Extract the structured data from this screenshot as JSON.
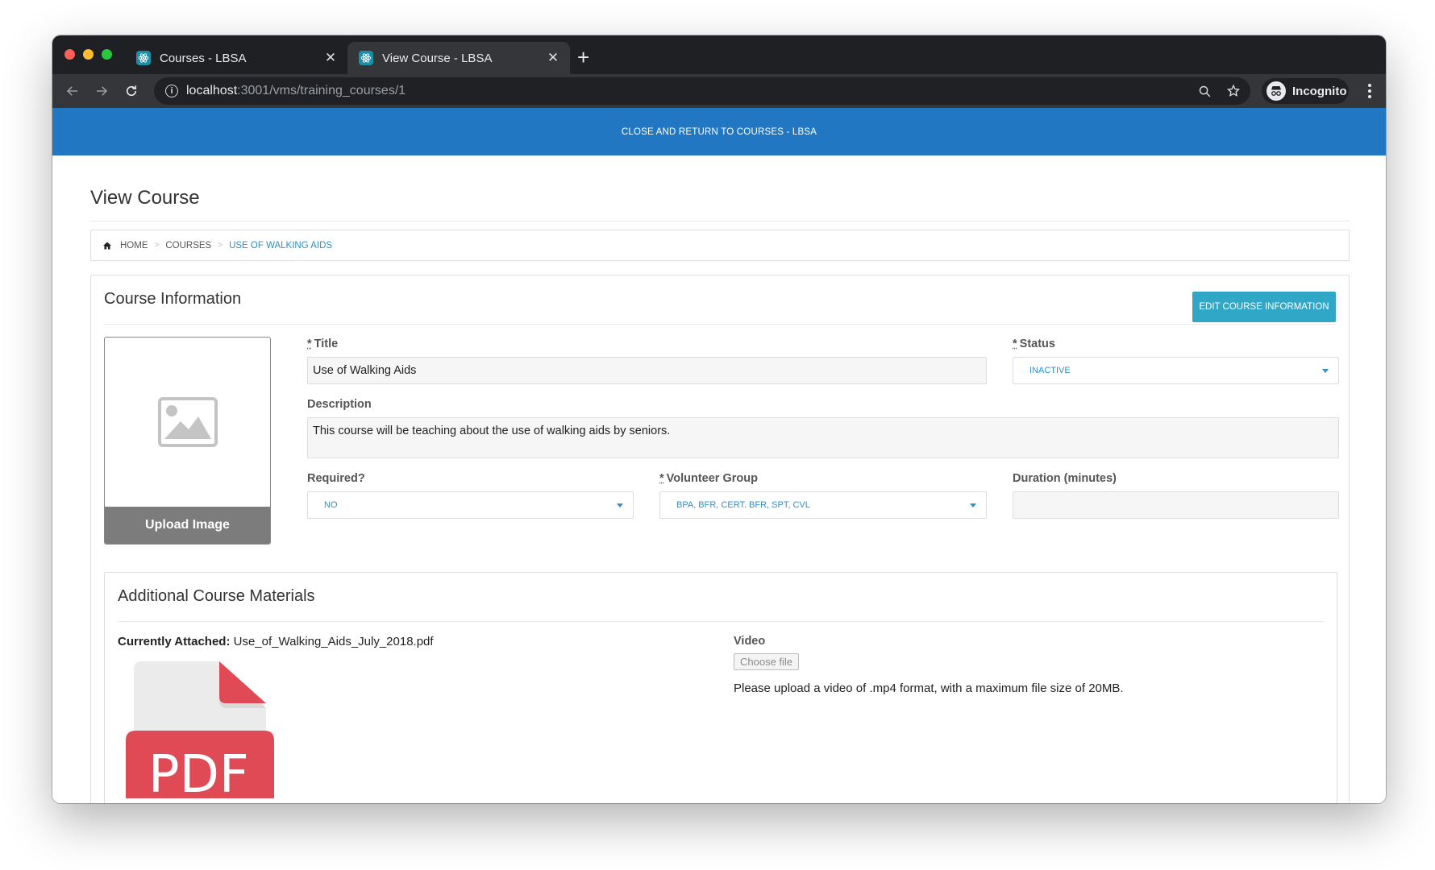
{
  "browser": {
    "tabs": [
      {
        "title": "Courses - LBSA",
        "close": "✕"
      },
      {
        "title": "View Course - LBSA",
        "close": "✕"
      }
    ],
    "new_tab": "+",
    "url_host": "localhost",
    "url_path": ":3001/vms/training_courses/1",
    "profile_label": "Incognito"
  },
  "banner": {
    "label": "CLOSE AND RETURN TO COURSES - LBSA"
  },
  "page": {
    "title": "View Course"
  },
  "breadcrumb": {
    "items": [
      "HOME",
      "COURSES",
      "USE OF WALKING AIDS"
    ],
    "separator": ">"
  },
  "course_info": {
    "heading": "Course Information",
    "edit_button": "EDIT COURSE INFORMATION",
    "upload_button": "Upload Image",
    "title_label": "Title",
    "title_value": "Use of Walking Aids",
    "status_label": "Status",
    "status_value": "INACTIVE",
    "description_label": "Description",
    "description_value": "This course will be teaching about the use of walking aids by seniors.",
    "required_label": "Required?",
    "required_value": "NO",
    "volunteer_group_label": "Volunteer Group",
    "volunteer_group_value": "BPA, BFR, CERT. BFR, SPT, CVL",
    "duration_label": "Duration (minutes)",
    "duration_value": "",
    "required_marker": "*"
  },
  "materials": {
    "heading": "Additional Course Materials",
    "attached_label": "Currently Attached:",
    "attached_file": " Use_of_Walking_Aids_July_2018.pdf",
    "pdf_icon_text": "PDF",
    "video_label": "Video",
    "choose_file": "Choose file",
    "video_note": "Please upload a video of .mp4 format, with a maximum file size of 20MB."
  },
  "colors": {
    "banner": "#2277c3",
    "accent_button": "#31a7c8",
    "link": "#2e8fc9",
    "pdf_red": "#e04a55"
  }
}
